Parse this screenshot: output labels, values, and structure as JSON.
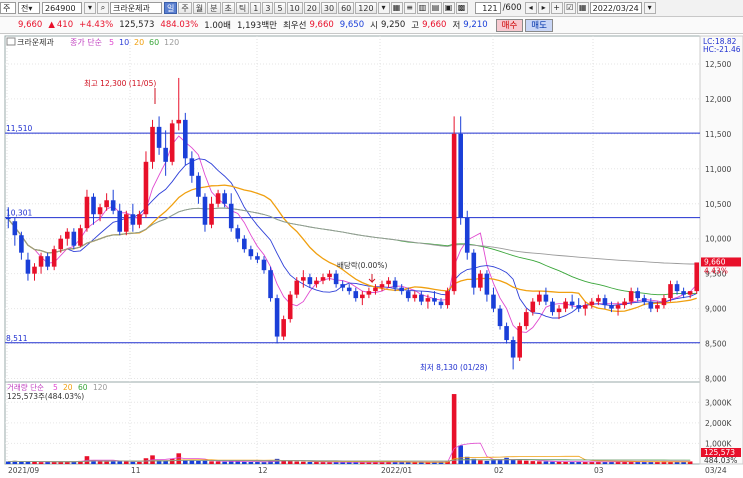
{
  "toolbar": {
    "menu_label": "주",
    "market_select": "전",
    "code_value": "264900",
    "stock_name": "크라운제과",
    "tabs": [
      "일",
      "주",
      "월",
      "분",
      "초",
      "틱"
    ],
    "minute_tabs": [
      "1",
      "3",
      "5",
      "10",
      "20",
      "30",
      "60",
      "120"
    ],
    "count_value": "121",
    "count_total": "/600",
    "date_value": "2022/03/24"
  },
  "quote": {
    "price": "9,660",
    "change_arrow": "▲",
    "change": "410",
    "change_rate": "+4.43%",
    "volume": "125,573",
    "volume_rate": "484.03%",
    "multiplier": "1.00배",
    "amount": "1,193백만",
    "ratio_label": "최우선",
    "best_ask": "9,660",
    "best_bid": "9,650",
    "open_label": "시",
    "open": "9,250",
    "high_label": "고",
    "high": "9,660",
    "low_label": "저",
    "low": "9,210",
    "buy_label": "매수",
    "sell_label": "매도"
  },
  "chart_data": {
    "type": "candlestick",
    "title": "크라운제과",
    "legend": {
      "label": "종가 단순",
      "periods": [
        "5",
        "10",
        "20",
        "60",
        "120"
      ],
      "colors": [
        "#e04ad0",
        "#2f40d8",
        "#f0a010",
        "#3aa63a",
        "#9a9a9a"
      ]
    },
    "price_axis": {
      "ticks": [
        "12,500",
        "12,000",
        "11,500",
        "11,000",
        "10,500",
        "10,000",
        "9,500",
        "9,000",
        "8,500",
        "8,000"
      ],
      "range": [
        7950,
        12900
      ]
    },
    "right_labels": {
      "lc": "LC:18.82",
      "hc": "HC:-21.46",
      "current_price": "9,660",
      "current_rate": "4.43%"
    },
    "horizontal_lines": [
      {
        "label": "11,510",
        "value": 11510
      },
      {
        "label": "10,301",
        "value": 10301
      },
      {
        "label": "8,511",
        "value": 8511
      }
    ],
    "annotations": {
      "high": "최고 12,300 (11/05)",
      "low": "최저 8,130 (01/28)",
      "dividend": "배당락(0.00%)"
    },
    "x_labels": [
      "2021/09",
      "11",
      "12",
      "2022/01",
      "02",
      "03"
    ],
    "prices": [
      [
        10300,
        10450,
        10150,
        10280
      ],
      [
        10250,
        10300,
        9900,
        10050
      ],
      [
        10050,
        10100,
        9700,
        9800
      ],
      [
        9700,
        9800,
        9400,
        9500
      ],
      [
        9500,
        9650,
        9400,
        9600
      ],
      [
        9600,
        9800,
        9500,
        9750
      ],
      [
        9750,
        9800,
        9550,
        9600
      ],
      [
        9600,
        9900,
        9550,
        9850
      ],
      [
        9850,
        10050,
        9800,
        10000
      ],
      [
        10000,
        10150,
        9900,
        10100
      ],
      [
        10100,
        10150,
        9850,
        9900
      ],
      [
        9900,
        10200,
        9880,
        10150
      ],
      [
        10150,
        10700,
        10100,
        10600
      ],
      [
        10600,
        10650,
        10200,
        10350
      ],
      [
        10350,
        10500,
        10250,
        10450
      ],
      [
        10450,
        10650,
        10400,
        10550
      ],
      [
        10550,
        10700,
        10350,
        10400
      ],
      [
        10400,
        10500,
        10050,
        10100
      ],
      [
        10100,
        10400,
        10050,
        10350
      ],
      [
        10350,
        10500,
        10100,
        10200
      ],
      [
        10200,
        10400,
        10150,
        10350
      ],
      [
        10350,
        11250,
        10300,
        11100
      ],
      [
        11100,
        11700,
        11000,
        11600
      ],
      [
        11600,
        11750,
        11200,
        11300
      ],
      [
        11300,
        11550,
        10900,
        11100
      ],
      [
        11100,
        11700,
        11050,
        11650
      ],
      [
        11650,
        12300,
        11550,
        11700
      ],
      [
        11700,
        11800,
        11050,
        11150
      ],
      [
        11150,
        11250,
        10800,
        10900
      ],
      [
        10900,
        10950,
        10500,
        10600
      ],
      [
        10600,
        10650,
        10100,
        10200
      ],
      [
        10200,
        10600,
        10150,
        10500
      ],
      [
        10500,
        10700,
        10450,
        10650
      ],
      [
        10650,
        10700,
        10450,
        10500
      ],
      [
        10500,
        10650,
        10100,
        10150
      ],
      [
        10150,
        10200,
        9950,
        10000
      ],
      [
        10000,
        10050,
        9800,
        9850
      ],
      [
        9850,
        9900,
        9700,
        9750
      ],
      [
        9750,
        9800,
        9650,
        9700
      ],
      [
        9700,
        9750,
        9500,
        9550
      ],
      [
        9550,
        9600,
        9100,
        9150
      ],
      [
        9150,
        9200,
        8500,
        8600
      ],
      [
        8600,
        8900,
        8550,
        8850
      ],
      [
        8850,
        9250,
        8800,
        9200
      ],
      [
        9200,
        9450,
        9150,
        9400
      ],
      [
        9400,
        9550,
        9300,
        9450
      ],
      [
        9450,
        9500,
        9300,
        9350
      ],
      [
        9350,
        9450,
        9300,
        9400
      ],
      [
        9400,
        9500,
        9350,
        9450
      ],
      [
        9450,
        9550,
        9400,
        9500
      ],
      [
        9500,
        9550,
        9300,
        9350
      ],
      [
        9350,
        9400,
        9250,
        9300
      ],
      [
        9300,
        9350,
        9200,
        9250
      ],
      [
        9250,
        9300,
        9100,
        9150
      ],
      [
        9150,
        9250,
        9050,
        9200
      ],
      [
        9200,
        9300,
        9150,
        9250
      ],
      [
        9250,
        9350,
        9200,
        9300
      ],
      [
        9300,
        9400,
        9250,
        9350
      ],
      [
        9350,
        9450,
        9300,
        9400
      ],
      [
        9400,
        9450,
        9250,
        9300
      ],
      [
        9300,
        9350,
        9200,
        9250
      ],
      [
        9250,
        9300,
        9100,
        9150
      ],
      [
        9150,
        9250,
        9100,
        9200
      ],
      [
        9200,
        9250,
        9050,
        9100
      ],
      [
        9100,
        9200,
        9000,
        9150
      ],
      [
        9150,
        9250,
        9050,
        9100
      ],
      [
        9100,
        9150,
        9000,
        9050
      ],
      [
        9050,
        9300,
        9000,
        9250
      ],
      [
        9250,
        11750,
        9200,
        11500
      ],
      [
        11500,
        11750,
        10200,
        10300
      ],
      [
        10300,
        10400,
        9700,
        9800
      ],
      [
        9800,
        9850,
        9200,
        9300
      ],
      [
        9300,
        9550,
        9250,
        9500
      ],
      [
        9500,
        9550,
        9100,
        9200
      ],
      [
        9200,
        9300,
        8950,
        9000
      ],
      [
        9000,
        9050,
        8700,
        8750
      ],
      [
        8750,
        8800,
        8500,
        8550
      ],
      [
        8550,
        8600,
        8130,
        8300
      ],
      [
        8300,
        8800,
        8250,
        8750
      ],
      [
        8750,
        9000,
        8700,
        8950
      ],
      [
        8950,
        9150,
        8900,
        9100
      ],
      [
        9100,
        9250,
        9050,
        9200
      ],
      [
        9200,
        9300,
        9050,
        9100
      ],
      [
        9100,
        9150,
        8900,
        8950
      ],
      [
        8950,
        9050,
        8850,
        9000
      ],
      [
        9000,
        9150,
        8950,
        9100
      ],
      [
        9100,
        9200,
        9000,
        9050
      ],
      [
        9050,
        9150,
        8950,
        9000
      ],
      [
        9000,
        9100,
        8900,
        9050
      ],
      [
        9050,
        9150,
        9000,
        9100
      ],
      [
        9100,
        9200,
        9050,
        9150
      ],
      [
        9150,
        9200,
        9000,
        9050
      ],
      [
        9050,
        9100,
        8950,
        9000
      ],
      [
        9000,
        9100,
        8900,
        9050
      ],
      [
        9050,
        9150,
        9000,
        9100
      ],
      [
        9100,
        9300,
        9050,
        9250
      ],
      [
        9250,
        9300,
        9100,
        9150
      ],
      [
        9150,
        9200,
        9050,
        9100
      ],
      [
        9100,
        9150,
        8950,
        9000
      ],
      [
        9000,
        9100,
        8950,
        9050
      ],
      [
        9050,
        9200,
        9000,
        9150
      ],
      [
        9150,
        9400,
        9100,
        9350
      ],
      [
        9350,
        9400,
        9200,
        9250
      ],
      [
        9250,
        9300,
        9150,
        9200
      ],
      [
        9200,
        9250,
        9150,
        9250
      ],
      [
        9250,
        9660,
        9210,
        9660
      ]
    ],
    "volume_panel": {
      "legend_label": "거래량 단순",
      "periods": [
        "5",
        "20",
        "60",
        "120"
      ],
      "value_label": "125,573주(484.03%)",
      "ticks": [
        "3,000K",
        "2,000K",
        "1,000K"
      ],
      "range": [
        0,
        3500
      ],
      "right_labels": {
        "current": "125,573",
        "rate": "484.03%"
      },
      "volumes": [
        120,
        140,
        110,
        130,
        100,
        90,
        110,
        95,
        130,
        120,
        110,
        150,
        380,
        160,
        140,
        130,
        150,
        170,
        120,
        110,
        100,
        280,
        420,
        180,
        160,
        250,
        520,
        210,
        180,
        150,
        160,
        130,
        120,
        110,
        140,
        130,
        110,
        100,
        95,
        90,
        150,
        250,
        180,
        140,
        120,
        110,
        100,
        95,
        90,
        85,
        90,
        80,
        85,
        90,
        80,
        85,
        90,
        95,
        100,
        90,
        85,
        80,
        85,
        90,
        85,
        80,
        90,
        120,
        3400,
        900,
        350,
        250,
        180,
        150,
        200,
        230,
        300,
        220,
        180,
        160,
        140,
        130,
        120,
        110,
        110,
        120,
        110,
        100,
        105,
        110,
        100,
        95,
        100,
        110,
        120,
        105,
        100,
        95,
        100,
        110,
        130,
        115,
        105,
        100,
        125
      ]
    },
    "date_axis_label": "03/24"
  }
}
